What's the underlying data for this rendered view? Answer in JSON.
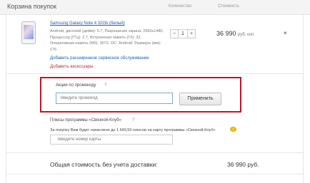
{
  "header": {
    "title": "Корзина покупок",
    "col_qty": "Количество",
    "col_price": "Стоимость"
  },
  "product": {
    "name": "Samsung Galaxy Note 4 32Gb (белый)",
    "description_lines": [
      "Android, дисплей (дюйм): 5.7, Разрешение экрана: 2560x1440,",
      "Процессор (ГГц): 2.7, Встроенная память (Гб): 32,",
      "Оперативная память (Мб): 3072, ОС: Android, Размеры (мм):",
      "176"
    ],
    "service_link": "Добавить расширенное сервисное обслуживание",
    "accessories_link": "Добавить аксессуары",
    "qty_minus": "−",
    "quantity": "1",
    "qty_plus": "+",
    "price": "36 990",
    "currency": "руб. коп.",
    "remove": "×"
  },
  "promo": {
    "label": "Акции по промокоду",
    "help": "?",
    "placeholder": "Введите промокод",
    "apply_button": "Применить"
  },
  "club": {
    "title": "Плюсы программы «Связной-Клуб»",
    "help": "?",
    "bonus_text": "За покупку Вам будет начислено до 1 649,50 плюсов на карту программы «Связной-Клуб»",
    "placeholder": "Введите номер карты"
  },
  "total": {
    "label": "Общая стоимость без учета доставки:",
    "value": "36 990 руб."
  }
}
